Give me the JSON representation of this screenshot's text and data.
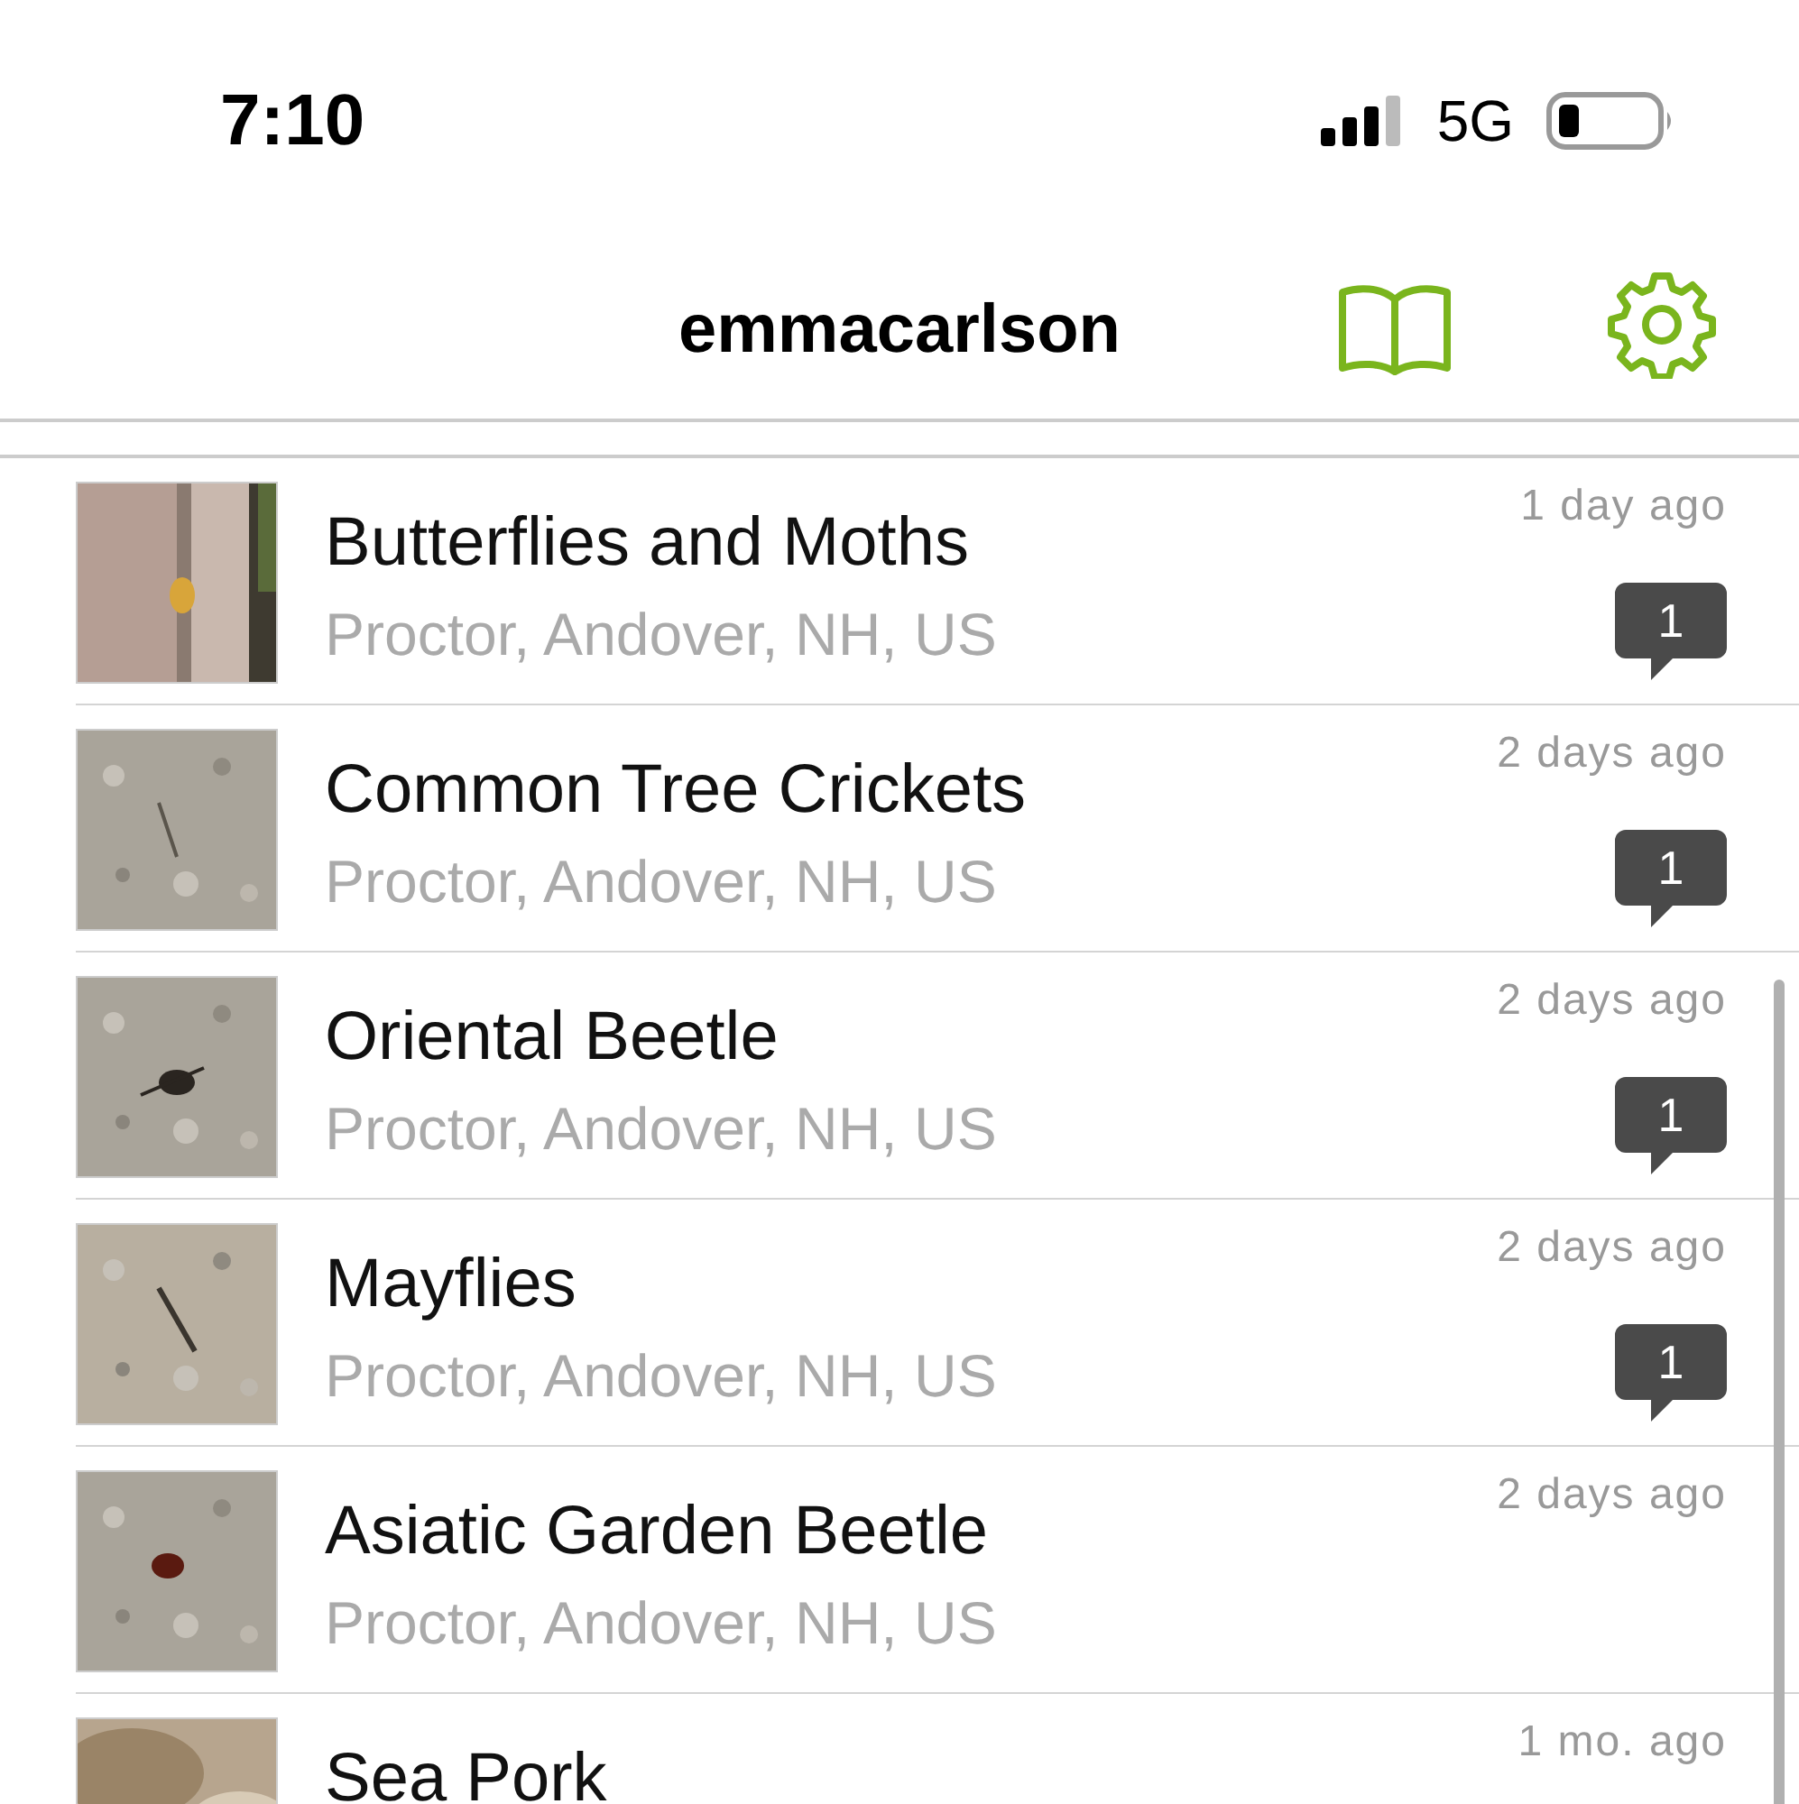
{
  "status_bar": {
    "time": "7:10",
    "network": "5G"
  },
  "header": {
    "title": "emmacarlson"
  },
  "observations": [
    {
      "title": "Butterflies and Moths",
      "place": "Proctor, Andover, NH, US",
      "when": "1 day ago",
      "comments": "1"
    },
    {
      "title": "Common Tree Crickets",
      "place": "Proctor, Andover, NH, US",
      "when": "2 days ago",
      "comments": "1"
    },
    {
      "title": "Oriental Beetle",
      "place": "Proctor, Andover, NH, US",
      "when": "2 days ago",
      "comments": "1"
    },
    {
      "title": "Mayflies",
      "place": "Proctor, Andover, NH, US",
      "when": "2 days ago",
      "comments": "1"
    },
    {
      "title": "Asiatic Garden Beetle",
      "place": "Proctor, Andover, NH, US",
      "when": "2 days ago"
    },
    {
      "title": "Sea Pork",
      "when": "1 mo. ago"
    }
  ]
}
